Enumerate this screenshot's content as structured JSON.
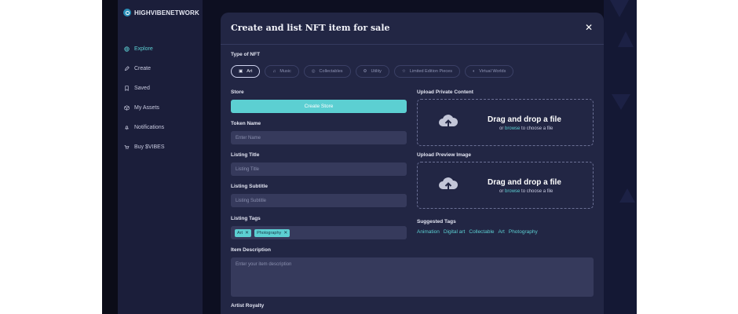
{
  "brand": {
    "name": "HIGHVIBENETWORK"
  },
  "sidebar": {
    "items": [
      {
        "label": "Explore",
        "icon": "globe-icon",
        "active": true
      },
      {
        "label": "Create",
        "icon": "pencil-icon",
        "active": false
      },
      {
        "label": "Saved",
        "icon": "bookmark-icon",
        "active": false
      },
      {
        "label": "My Assets",
        "icon": "box-icon",
        "active": false
      },
      {
        "label": "Notifications",
        "icon": "bell-icon",
        "active": false
      },
      {
        "label": "Buy $VIBES",
        "icon": "cart-icon",
        "active": false
      }
    ]
  },
  "modal": {
    "title": "Create and list NFT item for sale",
    "close": "✕",
    "type_label": "Type of NFT",
    "types": [
      {
        "label": "Art",
        "icon": "image-icon",
        "active": true
      },
      {
        "label": "Music",
        "icon": "music-icon",
        "active": false
      },
      {
        "label": "Collectables",
        "icon": "collectable-icon",
        "active": false
      },
      {
        "label": "Utility",
        "icon": "utility-icon",
        "active": false
      },
      {
        "label": "Limited Edition Pieces",
        "icon": "star-icon",
        "active": false
      },
      {
        "label": "Virtual Worlds",
        "icon": "vr-icon",
        "active": false
      }
    ],
    "store_label": "Store",
    "create_store_button": "Create Store",
    "token_name_label": "Token Name",
    "token_name_placeholder": "Enter Name",
    "listing_title_label": "Listing Title",
    "listing_title_placeholder": "Listing Title",
    "listing_subtitle_label": "Listing Subtitle",
    "listing_subtitle_placeholder": "Listing Subtitle",
    "listing_tags_label": "Listing Tags",
    "listing_tags": [
      "Art",
      "Photography"
    ],
    "upload_private_label": "Upload Private Content",
    "upload_preview_label": "Upload Preview Image",
    "dropzone_title": "Drag and drop a file",
    "dropzone_or": "or",
    "dropzone_browse": "browse",
    "dropzone_suffix": "to choose a file",
    "suggested_tags_label": "Suggested Tags",
    "suggested_tags": [
      "Animation",
      "Digital art",
      "Collectable",
      "Art",
      "Photography"
    ],
    "item_description_label": "Item Description",
    "item_description_placeholder": "Enter your item description",
    "artist_royalty_label": "Artist Royalty"
  },
  "colors": {
    "accent": "#5ccfd2",
    "sidebar": "#1b1e3a",
    "modal": "#222644",
    "input": "#363a5c"
  }
}
